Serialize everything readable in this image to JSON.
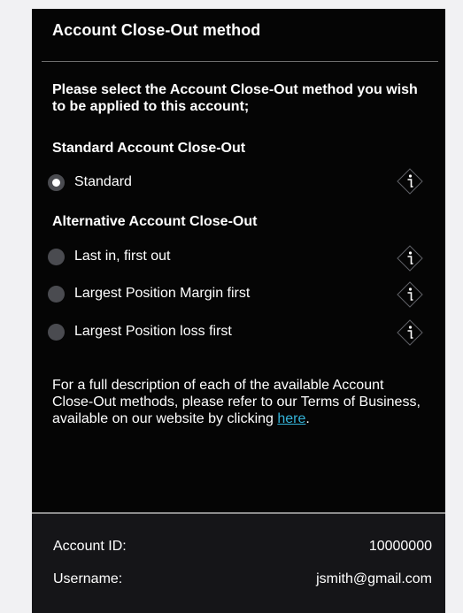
{
  "dialog": {
    "title": "Account Close-Out method",
    "prompt": "Please select the Account Close-Out method you wish to be applied to this account;"
  },
  "standard_section": {
    "title": "Standard Account Close-Out",
    "options": [
      {
        "label": "Standard",
        "checked": true
      }
    ]
  },
  "alternative_section": {
    "title": "Alternative Account Close-Out",
    "options": [
      {
        "label": "Last in, first out",
        "checked": false
      },
      {
        "label": "Largest Position Margin first",
        "checked": false
      },
      {
        "label": "Largest Position loss first",
        "checked": false
      }
    ]
  },
  "description": {
    "text": "For a full description of each of the available Account Close-Out methods, please refer to our Terms of Business, available on our website by clicking ",
    "link_text": "here",
    "suffix": "."
  },
  "account": {
    "id_label": "Account ID:",
    "id_value": "10000000",
    "username_label": "Username:",
    "username_value": "jsmith@gmail.com"
  },
  "icons": {
    "info": "info-icon"
  },
  "colors": {
    "panel_background": "#050505",
    "footer_background": "#151518",
    "link": "#34b3d8",
    "radio": "#4a4b50"
  }
}
